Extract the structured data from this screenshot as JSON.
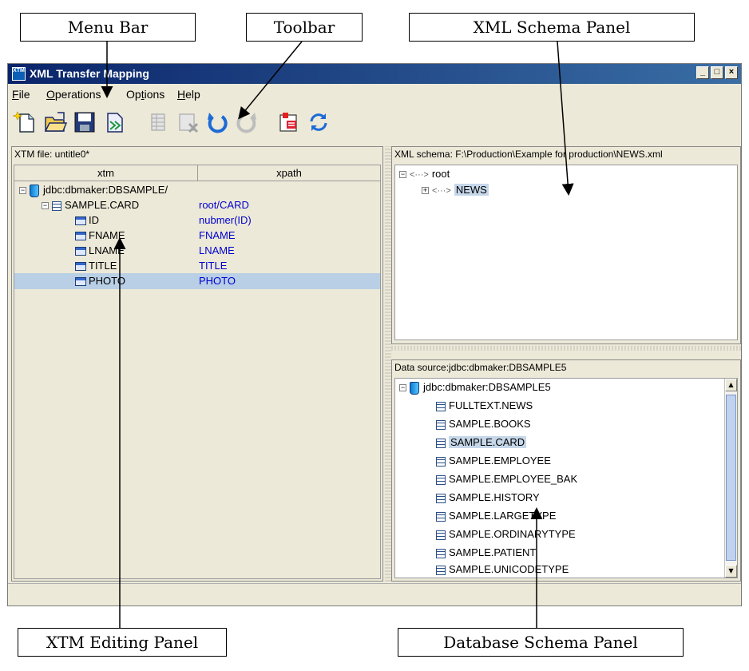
{
  "annotations": {
    "menu_bar": "Menu Bar",
    "toolbar": "Toolbar",
    "xml_schema_panel": "XML Schema Panel",
    "xtm_editing_panel": "XTM Editing Panel",
    "database_schema_panel": "Database Schema Panel"
  },
  "window": {
    "title": "XML Transfer Mapping",
    "app_icon_text": "XTM",
    "buttons": [
      "_",
      "□",
      "×"
    ]
  },
  "menu": {
    "items": [
      {
        "key": "F",
        "rest": "ile"
      },
      {
        "key": "O",
        "rest": "perations"
      },
      {
        "pre": "Op",
        "key": "t",
        "rest": "ions"
      },
      {
        "key": "H",
        "rest": "elp"
      }
    ]
  },
  "toolbar": {
    "buttons": [
      {
        "icon": "new-file-icon",
        "enabled": true
      },
      {
        "icon": "open-folder-icon",
        "enabled": true
      },
      {
        "icon": "save-disk-icon",
        "enabled": true
      },
      {
        "icon": "save-as-icon",
        "enabled": true
      },
      {
        "icon": "table-icon",
        "enabled": false
      },
      {
        "icon": "delete-icon",
        "enabled": false
      },
      {
        "icon": "undo-icon",
        "enabled": true
      },
      {
        "icon": "redo-icon",
        "enabled": false
      },
      {
        "icon": "xtm-convert-icon",
        "enabled": true
      },
      {
        "icon": "refresh-icon",
        "enabled": true
      }
    ]
  },
  "xtm_panel": {
    "label": "XTM file: untitle0*",
    "columns": [
      "xtm",
      "xpath"
    ],
    "rows": [
      {
        "name": "jdbc:dbmaker:DBSAMPLE/",
        "xpath": "",
        "level": 0,
        "icon": "database",
        "expander": "−"
      },
      {
        "name": "SAMPLE.CARD",
        "xpath": "root/CARD",
        "level": 1,
        "icon": "table",
        "expander": "−"
      },
      {
        "name": "ID",
        "xpath": "nubmer(ID)",
        "level": 2,
        "icon": "column"
      },
      {
        "name": "FNAME",
        "xpath": "FNAME",
        "level": 2,
        "icon": "column"
      },
      {
        "name": "LNAME",
        "xpath": "LNAME",
        "level": 2,
        "icon": "column"
      },
      {
        "name": "TITLE",
        "xpath": "TITLE",
        "level": 2,
        "icon": "column"
      },
      {
        "name": "PHOTO",
        "xpath": "PHOTO",
        "level": 2,
        "icon": "column",
        "selected": true
      }
    ]
  },
  "xml_schema": {
    "label": "XML schema: F:\\Production\\Example for production\\NEWS.xml",
    "nodes": [
      {
        "name": "root",
        "level": 0,
        "expander": "−"
      },
      {
        "name": "NEWS",
        "level": 1,
        "expander": "+",
        "highlighted": true
      }
    ]
  },
  "data_source": {
    "label": "Data source:jdbc:dbmaker:DBSAMPLE5",
    "root": "jdbc:dbmaker:DBSAMPLE5",
    "tables": [
      "FULLTEXT.NEWS",
      "SAMPLE.BOOKS",
      "SAMPLE.CARD",
      "SAMPLE.EMPLOYEE",
      "SAMPLE.EMPLOYEE_BAK",
      "SAMPLE.HISTORY",
      "SAMPLE.LARGETYPE",
      "SAMPLE.ORDINARYTYPE",
      "SAMPLE.PATIENT",
      "SAMPLE.UNICODETYPE"
    ],
    "highlighted_table": "SAMPLE.CARD"
  }
}
